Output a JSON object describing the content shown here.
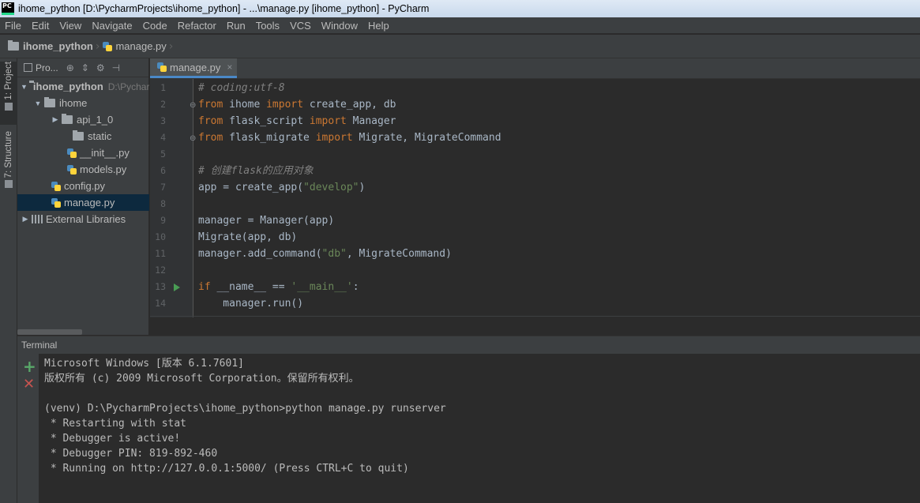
{
  "window": {
    "title": "ihome_python [D:\\PycharmProjects\\ihome_python] - ...\\manage.py [ihome_python] - PyCharm",
    "logo_text": "PC"
  },
  "menu": [
    "File",
    "Edit",
    "View",
    "Navigate",
    "Code",
    "Refactor",
    "Run",
    "Tools",
    "VCS",
    "Window",
    "Help"
  ],
  "navbar": {
    "project": "ihome_python",
    "file": "manage.py"
  },
  "tool_strip": {
    "project_tab": "1: Project",
    "structure_tab": "7: Structure"
  },
  "project_panel": {
    "view_label": "Pro...",
    "tree": [
      {
        "label": "ihome_python",
        "hint": "D:\\PycharmProjects\\ihome_python",
        "kind": "folder",
        "expanded": true
      },
      {
        "label": "ihome",
        "hint": "",
        "kind": "folder",
        "expanded": true
      },
      {
        "label": "api_1_0",
        "hint": "",
        "kind": "folder",
        "expanded": false
      },
      {
        "label": "static",
        "hint": "",
        "kind": "folder",
        "expanded": null
      },
      {
        "label": "__init__.py",
        "hint": "",
        "kind": "python"
      },
      {
        "label": "models.py",
        "hint": "",
        "kind": "python"
      },
      {
        "label": "config.py",
        "hint": "",
        "kind": "python"
      },
      {
        "label": "manage.py",
        "hint": "",
        "kind": "python",
        "selected": true
      },
      {
        "label": "External Libraries",
        "hint": "",
        "kind": "library",
        "expanded": false
      }
    ]
  },
  "editor": {
    "tab_label": "manage.py",
    "tab_close": "×",
    "line_numbers": [
      "1",
      "2",
      "3",
      "4",
      "5",
      "6",
      "7",
      "8",
      "9",
      "10",
      "11",
      "12",
      "13",
      "14"
    ],
    "code_lines": [
      "# coding:utf-8",
      "from ihome import create_app, db",
      "from flask_script import Manager",
      "from flask_migrate import Migrate, MigrateCommand",
      "",
      "# 创建flask的应用对象",
      "app = create_app(\"develop\")",
      "",
      "manager = Manager(app)",
      "Migrate(app, db)",
      "manager.add_command(\"db\", MigrateCommand)",
      "",
      "if __name__ == '__main__':",
      "    manager.run()"
    ]
  },
  "terminal": {
    "header": "Terminal",
    "add_icon": "+",
    "close_icon": "✕",
    "lines": [
      "Microsoft Windows [版本 6.1.7601]",
      "版权所有 (c) 2009 Microsoft Corporation。保留所有权利。",
      "",
      "(venv) D:\\PycharmProjects\\ihome_python>python manage.py runserver",
      " * Restarting with stat",
      " * Debugger is active!",
      " * Debugger PIN: 819-892-460",
      " * Running on http://127.0.0.1:5000/ (Press CTRL+C to quit)"
    ]
  },
  "colors": {
    "background": "#2b2b2b",
    "panel": "#3c3f41",
    "keyword": "#cc7832",
    "string": "#6a8759",
    "comment": "#808080",
    "selection": "#0d293e"
  }
}
